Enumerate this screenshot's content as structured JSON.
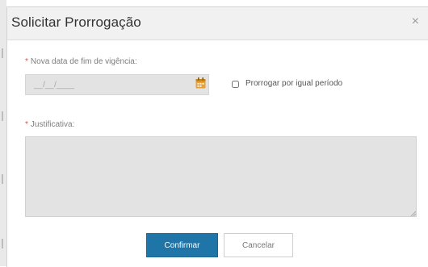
{
  "dialog": {
    "title": "Solicitar Prorrogação",
    "close_label": "×"
  },
  "form": {
    "date_field": {
      "required_marker": "*",
      "label": "Nova data de fim de vigência:",
      "placeholder": "__/__/____",
      "icon": "calendar-icon"
    },
    "extend_checkbox": {
      "label": "Prorrogar por igual período",
      "checked": false
    },
    "justification_field": {
      "required_marker": "*",
      "label": "Justificativa:",
      "value": ""
    }
  },
  "actions": {
    "confirm_label": "Confirmar",
    "cancel_label": "Cancelar"
  },
  "colors": {
    "primary": "#1f74a8",
    "required": "#e2503d",
    "calendar_icon": "#e6a23c",
    "input_bg": "#e3e3e3",
    "header_bg": "#f1f1f1"
  }
}
